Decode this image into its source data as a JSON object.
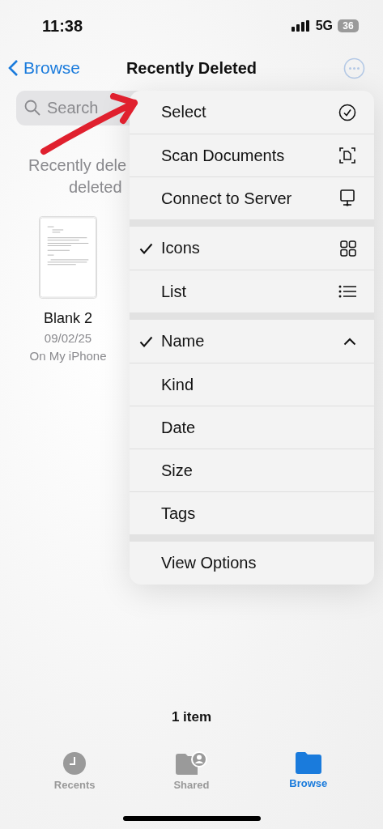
{
  "status_bar": {
    "time": "11:38",
    "network": "5G",
    "battery": "36"
  },
  "nav": {
    "back": "Browse",
    "title": "Recently Deleted"
  },
  "search": {
    "placeholder": "Search"
  },
  "empty_message_lines": [
    "Recently dele",
    "deleted"
  ],
  "files": [
    {
      "name": "Blank 2",
      "date": "09/02/25",
      "location": "On My iPhone"
    }
  ],
  "menu": {
    "sections": [
      {
        "items": [
          {
            "label": "Select"
          },
          {
            "label": "Scan Documents"
          },
          {
            "label": "Connect to Server"
          }
        ]
      },
      {
        "items": [
          {
            "label": "Icons",
            "checked": true
          },
          {
            "label": "List",
            "checked": false
          }
        ]
      },
      {
        "items": [
          {
            "label": "Name",
            "checked": true
          },
          {
            "label": "Kind",
            "checked": false
          },
          {
            "label": "Date",
            "checked": false
          },
          {
            "label": "Size",
            "checked": false
          },
          {
            "label": "Tags",
            "checked": false
          }
        ]
      },
      {
        "items": [
          {
            "label": "View Options"
          }
        ]
      }
    ]
  },
  "item_count": "1 item",
  "tab_bar": [
    {
      "label": "Recents",
      "selected": false
    },
    {
      "label": "Shared",
      "selected": false
    },
    {
      "label": "Browse",
      "selected": true
    }
  ]
}
